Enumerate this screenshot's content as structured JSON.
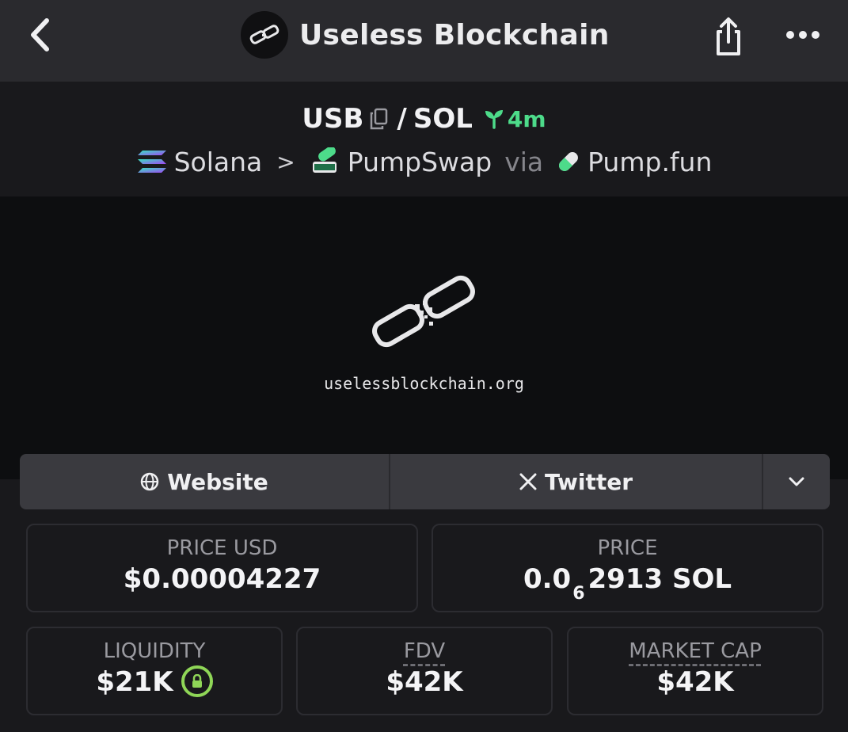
{
  "header": {
    "title": "Useless Blockchain",
    "back_icon": "chevron-left-icon",
    "share_icon": "share-icon",
    "more_icon": "more-horizontal-icon"
  },
  "pair": {
    "base": "USB",
    "sep": "/",
    "quote": "SOL",
    "age": "4m",
    "age_color": "#4ddb8a"
  },
  "chain": {
    "network": "Solana",
    "separator": ">",
    "dex": "PumpSwap",
    "via": "via",
    "launchpad": "Pump.fun"
  },
  "banner": {
    "domain": "uselessblockchain.org"
  },
  "links": {
    "website": "Website",
    "twitter": "Twitter"
  },
  "stats": {
    "price_usd_label": "PRICE USD",
    "price_usd_value": "$0.00004227",
    "price_label": "PRICE",
    "price_prefix": "0.0",
    "price_sub": "6",
    "price_digits": "2913",
    "price_unit": "SOL",
    "liquidity_label": "LIQUIDITY",
    "liquidity_value": "$21K",
    "fdv_label": "FDV",
    "fdv_value": "$42K",
    "mcap_label": "MARKET CAP",
    "mcap_value": "$42K"
  },
  "colors": {
    "accent_green": "#4ddb8a",
    "lock_green": "#8fd657"
  }
}
